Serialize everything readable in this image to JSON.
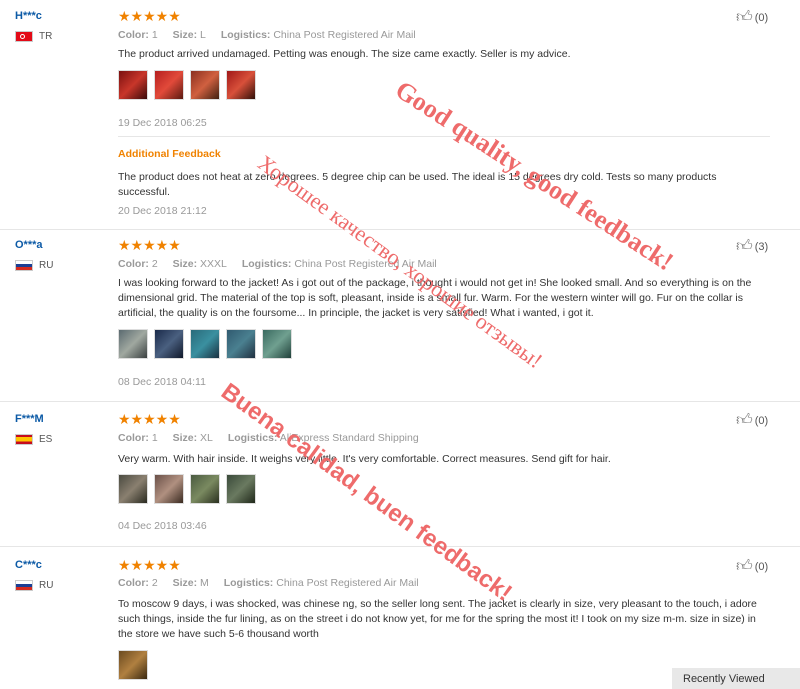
{
  "reviews": [
    {
      "user": "H***c",
      "country": "TR",
      "stars": "★★★★★",
      "color_label": "Color:",
      "color": "1",
      "size_label": "Size:",
      "size": "L",
      "logistics_label": "Logistics:",
      "logistics": "China Post Registered Air Mail",
      "text": "The product arrived undamaged. Petting was enough. The size came exactly. Seller is my advice.",
      "date": "19 Dec 2018 06:25",
      "likes": "(0)",
      "additional_label": "Additional Feedback",
      "additional_text": "The product does not heat at zero degrees. 5 degree chip can be used. The ideal is 15 degrees dry cold. Tests so many products successful.",
      "additional_date": "20 Dec 2018 21:12"
    },
    {
      "user": "O***a",
      "country": "RU",
      "stars": "★★★★★",
      "color_label": "Color:",
      "color": "2",
      "size_label": "Size:",
      "size": "XXXL",
      "logistics_label": "Logistics:",
      "logistics": "China Post Registered Air Mail",
      "text": "I was looking forward to the jacket! As i got out of the package, i thought i would not get in! She looked small. And so everything is on the dimensional grid. The material of the top is soft, pleasant, inside is a small fur. Warm. For the western winter will go. Fur on the collar is artificial, the quality is on the foursome... In principle, the jacket is very satisfied! What i wanted, i got it.",
      "date": "08 Dec 2018 04:11",
      "likes": "(3)"
    },
    {
      "user": "F***M",
      "country": "ES",
      "stars": "★★★★★",
      "color_label": "Color:",
      "color": "1",
      "size_label": "Size:",
      "size": "XL",
      "logistics_label": "Logistics:",
      "logistics": "AliExpress Standard Shipping",
      "text": "Very warm. With hair inside. It weighs very little. It's very comfortable. Correct measures. Send gift for hair.",
      "date": "04 Dec 2018 03:46",
      "likes": "(0)"
    },
    {
      "user": "C***c",
      "country": "RU",
      "stars": "★★★★★",
      "color_label": "Color:",
      "color": "2",
      "size_label": "Size:",
      "size": "M",
      "logistics_label": "Logistics:",
      "logistics": "China Post Registered Air Mail",
      "text": "To moscow 9 days, i was shocked, was chinese ng, so the seller long sent. The jacket is clearly in size, very pleasant to the touch, i adore such things, inside the fur lining, as on the street i do not know yet, for me for the spring the most it! I took on my size m-m. size in size) in the store we have such 5-6 thousand worth",
      "likes": "(0)"
    }
  ],
  "watermarks": {
    "w1": "Good quality, good feedback!",
    "w2": "Хорошее качество, хорошие отзывы!",
    "w3": "Buena calidad, buen feedback!"
  },
  "recently_viewed": "Recently Viewed",
  "icons": {
    "like": "thumbs-up-icon",
    "star": "star-icon"
  },
  "colors": {
    "username": "#0c5aa6",
    "stars": "#f08200",
    "additional": "#f08200",
    "watermark": "#ee6b6b"
  }
}
